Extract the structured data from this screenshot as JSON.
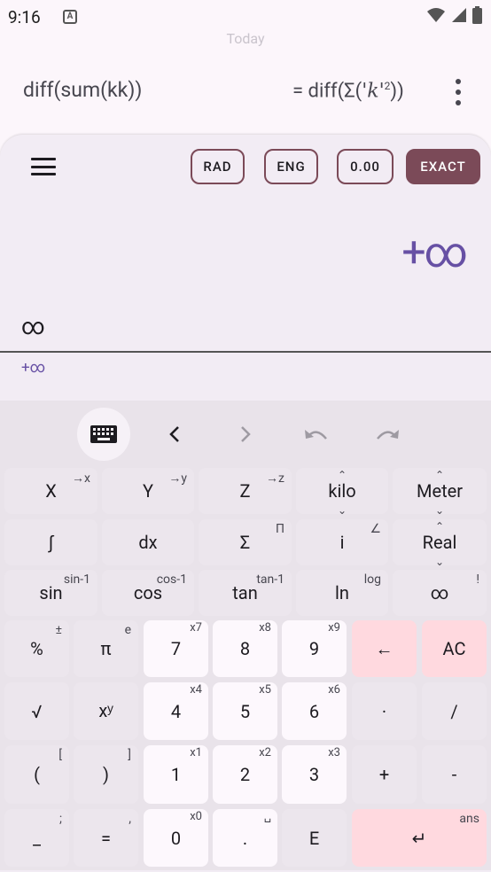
{
  "status": {
    "time": "9:16",
    "app_icon_letter": "A"
  },
  "history": {
    "day": "Today",
    "expression": "diff(sum(kk))",
    "result_prefix": "= diff(Σ(",
    "result_var": "'k'",
    "result_exp": "2",
    "result_suffix": "))"
  },
  "modes": {
    "angle": "RAD",
    "notation": "ENG",
    "precision": "0.00",
    "exact": "EXACT"
  },
  "display": {
    "result": "+∞",
    "input": "∞",
    "preview": "+∞"
  },
  "toolbar": {
    "keyboard": "keyboard",
    "left": "‹",
    "right": "›"
  },
  "rows": {
    "r1": [
      {
        "main": "X",
        "sup": "→x"
      },
      {
        "main": "Y",
        "sup": "→y"
      },
      {
        "main": "Z",
        "sup": "→z"
      },
      {
        "main": "kilo",
        "up": "⌃",
        "down": "⌄"
      },
      {
        "main": "Meter",
        "up": "⌃",
        "down": "⌄"
      }
    ],
    "r2": [
      {
        "main": "∫",
        "sup": ""
      },
      {
        "main": "dx",
        "sup": ""
      },
      {
        "main": "Σ",
        "sup": "Π"
      },
      {
        "main": "i",
        "sup": "∠"
      },
      {
        "main": "Real",
        "up": "⌃",
        "down": "⌄"
      }
    ],
    "r3": [
      {
        "main": "sin",
        "sup": "sin-1"
      },
      {
        "main": "cos",
        "sup": "cos-1"
      },
      {
        "main": "tan",
        "sup": "tan-1"
      },
      {
        "main": "ln",
        "sup": "log"
      },
      {
        "main": "∞",
        "sup": "!"
      }
    ],
    "r4": [
      {
        "main": "%",
        "sup": "±"
      },
      {
        "main": "π",
        "sup": "e"
      },
      {
        "main": "7",
        "sup": "x7"
      },
      {
        "main": "8",
        "sup": "x8"
      },
      {
        "main": "9",
        "sup": "x9"
      },
      {
        "main": "←",
        "sup": ""
      },
      {
        "main": "AC",
        "sup": ""
      }
    ],
    "r5": [
      {
        "main": "√",
        "sup": ""
      },
      {
        "main": "xʸ",
        "sup": ""
      },
      {
        "main": "4",
        "sup": "x4"
      },
      {
        "main": "5",
        "sup": "x5"
      },
      {
        "main": "6",
        "sup": "x6"
      },
      {
        "main": "·",
        "sup": ""
      },
      {
        "main": "/",
        "sup": ""
      }
    ],
    "r6": [
      {
        "main": "(",
        "sup": "["
      },
      {
        "main": ")",
        "sup": "]"
      },
      {
        "main": "1",
        "sup": "x1"
      },
      {
        "main": "2",
        "sup": "x2"
      },
      {
        "main": "3",
        "sup": "x3"
      },
      {
        "main": "+",
        "sup": ""
      },
      {
        "main": "-",
        "sup": ""
      }
    ],
    "r7": [
      {
        "main": "_",
        "sup": ";"
      },
      {
        "main": "=",
        "sup": ","
      },
      {
        "main": "0",
        "sup": "x0"
      },
      {
        "main": ".",
        "sup": "␣"
      },
      {
        "main": "E",
        "sup": ""
      },
      {
        "main": "↵",
        "sup": "ans"
      }
    ]
  }
}
